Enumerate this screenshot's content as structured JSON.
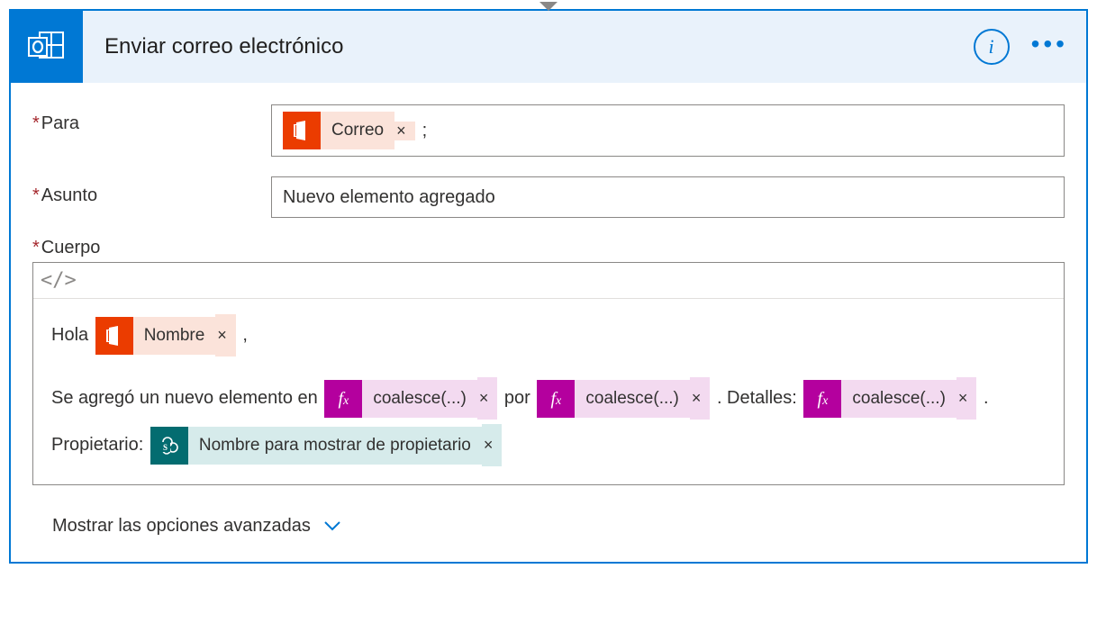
{
  "header": {
    "title": "Enviar correo electrónico"
  },
  "fields": {
    "para_label": "Para",
    "asunto_label": "Asunto",
    "asunto_value": "Nuevo elemento agregado",
    "cuerpo_label": "Cuerpo",
    "para_suffix": ";"
  },
  "tokens": {
    "correo": "Correo",
    "nombre": "Nombre",
    "coalesce": "coalesce(...)",
    "owner_display": "Nombre para mostrar de propietario"
  },
  "body_text": {
    "hola": "Hola ",
    "comma": ",",
    "line2a": "Se agregó un nuevo elemento en ",
    "por": " por ",
    "detalles": ". Detalles: ",
    "period": ".",
    "propietario": " Propietario: "
  },
  "footer": {
    "advanced": "Mostrar las opciones avanzadas"
  },
  "glyphs": {
    "x": "×",
    "code": "</>"
  }
}
